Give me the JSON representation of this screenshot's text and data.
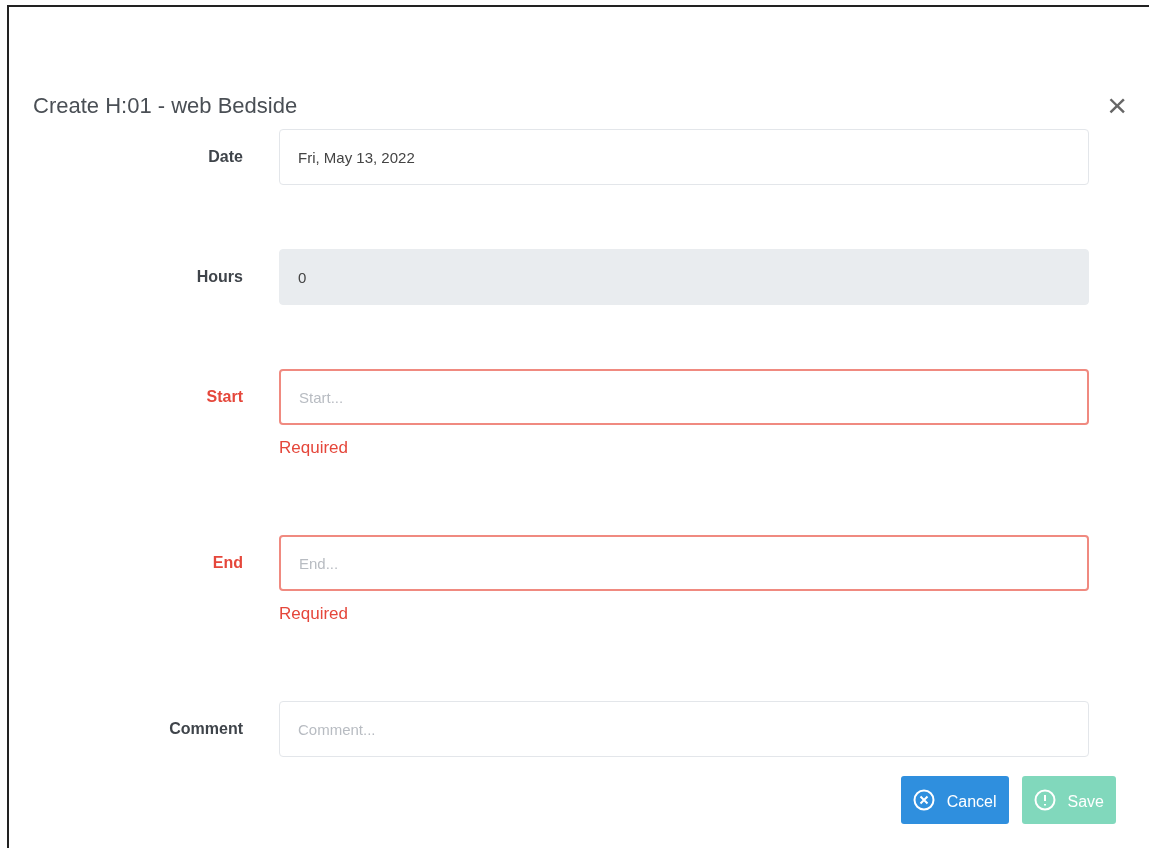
{
  "dialog": {
    "title": "Create H:01 - web Bedside",
    "close_icon": "×"
  },
  "fields": [
    {
      "label": "Date",
      "value": "Fri, May 13, 2022",
      "disabled": false,
      "invalid": false
    },
    {
      "label": "Hours",
      "value": "0",
      "disabled": true,
      "invalid": false
    },
    {
      "label": "Start",
      "placeholder": "Start...",
      "disabled": false,
      "invalid": true,
      "error": "Required"
    },
    {
      "label": "End",
      "placeholder": "End...",
      "disabled": false,
      "invalid": true,
      "error": "Required"
    },
    {
      "label": "Comment",
      "placeholder": "Comment...",
      "disabled": false,
      "invalid": false
    }
  ],
  "buttons": [
    {
      "label": "Cancel",
      "kind": "cancel",
      "disabled": false
    },
    {
      "label": "Save",
      "kind": "save",
      "disabled": true
    }
  ]
}
